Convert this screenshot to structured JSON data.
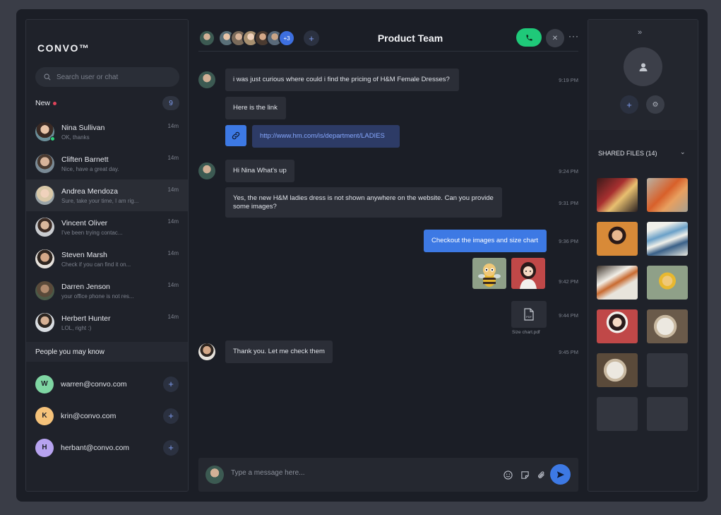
{
  "app": {
    "logo": "CONVO™"
  },
  "search": {
    "placeholder": "Search user or chat"
  },
  "new_section": {
    "label": "New",
    "count": "9"
  },
  "contacts": [
    {
      "name": "Nina Sullivan",
      "preview": "OK, thanks",
      "time": "14m",
      "online": true
    },
    {
      "name": "Cliften Barnett",
      "preview": "Nice, have a great day.",
      "time": "14m"
    },
    {
      "name": "Andrea Mendoza",
      "preview": "Sure, take your time, I am rig...",
      "time": "14m",
      "active": true
    },
    {
      "name": "Vincent Oliver",
      "preview": "I've been trying contac...",
      "time": "14m"
    },
    {
      "name": "Steven Marsh",
      "preview": "Check if you can find it on...",
      "time": "14m"
    },
    {
      "name": "Darren Jenson",
      "preview": "your office phone is not res...",
      "time": "14m"
    },
    {
      "name": "Herbert Hunter",
      "preview": "LOL, right :)",
      "time": "14m"
    }
  ],
  "people_you_may_know": {
    "title": "People you may know",
    "items": [
      {
        "initial": "W",
        "email": "warren@convo.com",
        "color": "#7fd6a3"
      },
      {
        "initial": "K",
        "email": "krin@convo.com",
        "color": "#f5c27a"
      },
      {
        "initial": "H",
        "email": "herbant@convo.com",
        "color": "#b7a3f0"
      }
    ]
  },
  "chat": {
    "title": "Product Team",
    "members_more": "+3",
    "messages": [
      {
        "text": "i was just curious where could i find the pricing of H&M Female Dresses?",
        "time": "9:19 PM"
      },
      {
        "text": "Here is the link"
      },
      {
        "link": "http://www.hm.com/is/department/LADIES"
      },
      {
        "text": "Hi Nina What's up",
        "time": "9:24 PM"
      },
      {
        "text": "Yes, the new H&M ladies dress is not shown anywhere on the website. Can you provide some images?",
        "time": "9:31 PM"
      },
      {
        "text": "Checkout the images and size chart",
        "time": "9:36 PM"
      },
      {
        "time": "9:42 PM"
      },
      {
        "file": "Size chart.pdf",
        "file_badge": "PDF",
        "time": "9:44 PM"
      },
      {
        "text": "Thank you. Let me check them",
        "time": "9:45 PM"
      }
    ]
  },
  "composer": {
    "placeholder": "Type a message here..."
  },
  "right_panel": {
    "shared_files_label": "SHARED FILES (14)"
  },
  "colors": {
    "accent": "#3d79e4",
    "call": "#1fc979",
    "background": "#1b1e26"
  },
  "icons": [
    "search-icon",
    "phone-icon",
    "close-icon",
    "more-icon",
    "link-icon",
    "pdf-file-icon",
    "emoji-icon",
    "sticker-icon",
    "attach-icon",
    "send-icon",
    "expand-icon",
    "user-icon",
    "settings-icon",
    "chevron-down-icon",
    "plus-icon"
  ]
}
